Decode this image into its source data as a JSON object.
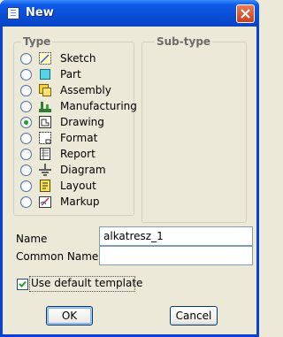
{
  "window": {
    "title": "New"
  },
  "type_group": {
    "legend": "Type",
    "items": [
      {
        "label": "Sketch",
        "icon": "sketch-icon",
        "selected": false
      },
      {
        "label": "Part",
        "icon": "part-icon",
        "selected": false
      },
      {
        "label": "Assembly",
        "icon": "assembly-icon",
        "selected": false
      },
      {
        "label": "Manufacturing",
        "icon": "manufacturing-icon",
        "selected": false
      },
      {
        "label": "Drawing",
        "icon": "drawing-icon",
        "selected": true
      },
      {
        "label": "Format",
        "icon": "format-icon",
        "selected": false
      },
      {
        "label": "Report",
        "icon": "report-icon",
        "selected": false
      },
      {
        "label": "Diagram",
        "icon": "diagram-icon",
        "selected": false
      },
      {
        "label": "Layout",
        "icon": "layout-icon",
        "selected": false
      },
      {
        "label": "Markup",
        "icon": "markup-icon",
        "selected": false
      }
    ]
  },
  "subtype_group": {
    "legend": "Sub-type"
  },
  "fields": {
    "name_label": "Name",
    "name_value": "alkatresz_1",
    "common_name_label": "Common Name",
    "common_name_value": ""
  },
  "options": {
    "use_default_template_label": "Use default template",
    "use_default_template_checked": true
  },
  "buttons": {
    "ok_label": "OK",
    "cancel_label": "Cancel"
  },
  "colors": {
    "title_bar": "#0A4FD8",
    "close_button": "#C8401E",
    "dialog_bg": "#ECE9D8",
    "radio_selected": "#21A121"
  }
}
